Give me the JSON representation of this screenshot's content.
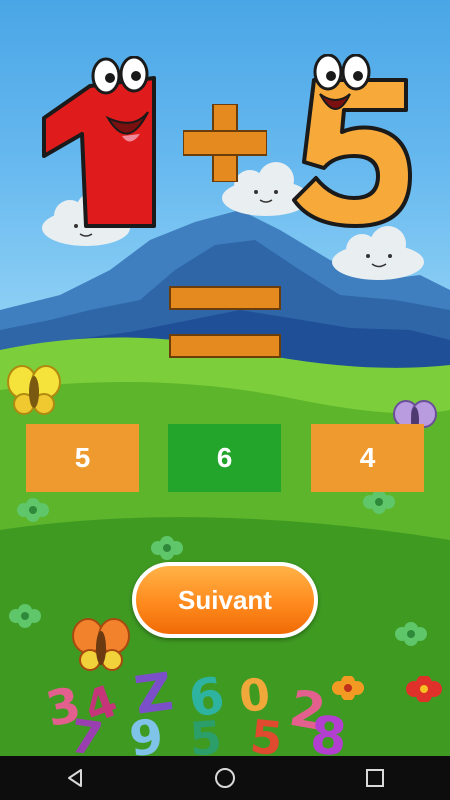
{
  "game": {
    "operand_a": "1",
    "operator": "+",
    "operand_b": "5",
    "equals": "=",
    "answers": [
      "5",
      "6",
      "4"
    ],
    "next_label": "Suivant"
  },
  "colors": {
    "answer_default": "#ef9a2e",
    "answer_correct": "#22a52a",
    "operator": "#e58a1f",
    "digit_one": "#e01b1b",
    "digit_five": "#f7a93a",
    "button": "#ff8a1e"
  },
  "navbar": {
    "back_icon": "back-triangle-icon",
    "home_icon": "home-circle-icon",
    "recents_icon": "recents-square-icon"
  }
}
